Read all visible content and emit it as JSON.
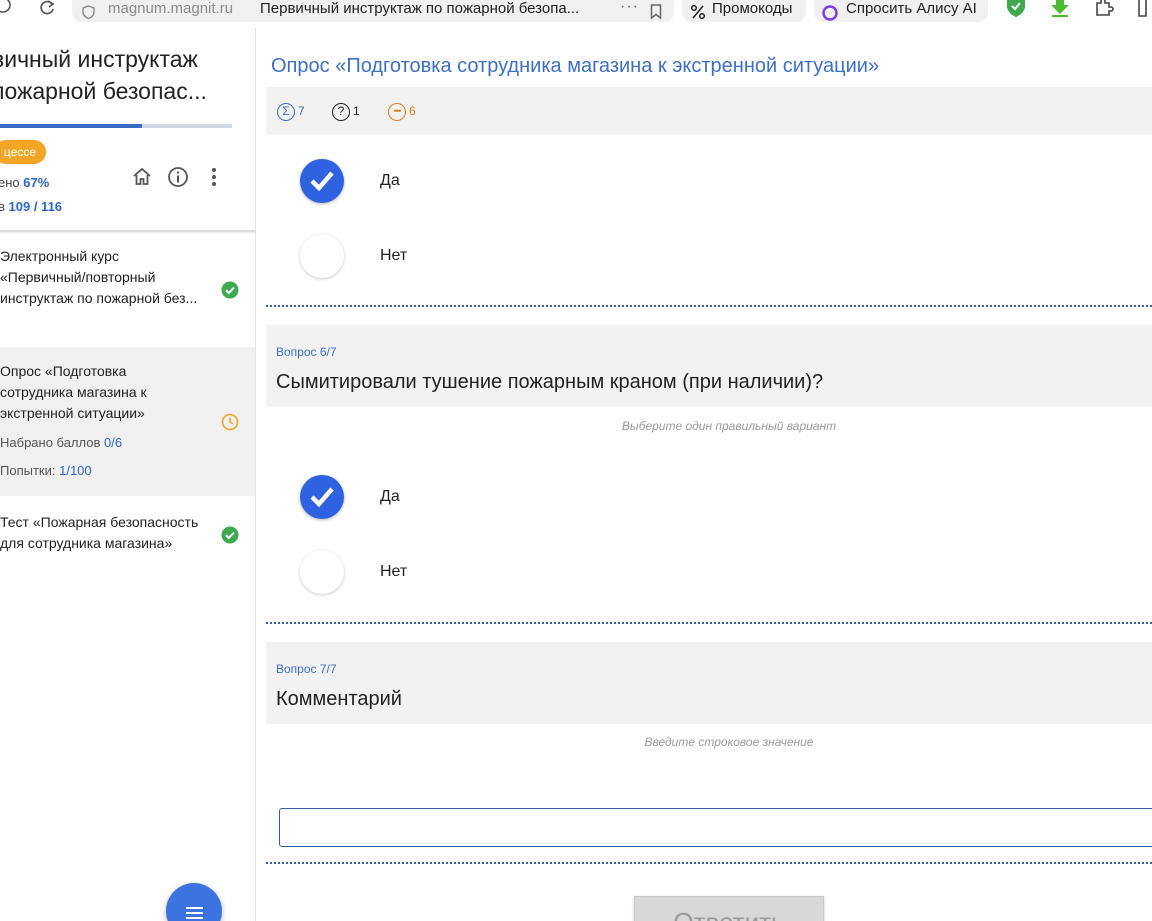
{
  "browser": {
    "domain": "magnum.magnit.ru",
    "page_title": "Первичный инструктаж по пожарной безопа...",
    "promo_label": "Промокоды",
    "alice_label": "Спросить Алису AI"
  },
  "sidebar": {
    "title_line1": "вичный инструктаж",
    "title_line2": "пожарной безопас...",
    "progress_fraction": 0.61,
    "status_badge": "цессе",
    "completed_label": "ено",
    "completed_value": "67%",
    "points_label": "в",
    "points_value": "109 / 116",
    "items": [
      {
        "label": "Электронный курс «Первичный/повторный инструктаж по пожарной без...",
        "status": "completed"
      },
      {
        "label": "Опрос «Подготовка сотрудника магазина к экстренной ситуации»",
        "status": "in-progress",
        "score_label": "Набрано баллов",
        "score_value": "0/6",
        "attempts_label": "Попытки:",
        "attempts_value": "1/100"
      },
      {
        "label": "Тест «Пожарная безопасность для сотрудника магазина»",
        "status": "completed"
      }
    ]
  },
  "main": {
    "title": "Опрос «Подготовка сотрудника магазина к экстренной ситуации»",
    "toolbar": {
      "total": "7",
      "unanswered": "1",
      "pending": "6"
    },
    "q5": {
      "options": [
        {
          "label": "Да",
          "checked": true
        },
        {
          "label": "Нет",
          "checked": false
        }
      ]
    },
    "q6": {
      "number": "Вопрос 6/7",
      "text": "Сымитировали тушение пожарным краном (при наличии)?",
      "hint": "Выберите один правильный вариант",
      "options": [
        {
          "label": "Да",
          "checked": true
        },
        {
          "label": "Нет",
          "checked": false
        }
      ]
    },
    "q7": {
      "number": "Вопрос 7/7",
      "text": "Комментарий",
      "hint": "Введите строковое значение",
      "value": ""
    },
    "submit_label": "Ответить"
  },
  "colors": {
    "accent": "#3d6fc4",
    "radio_checked": "#2f62e0",
    "badge": "#f2a623",
    "success": "#3daa4f",
    "warning": "#f2a623"
  }
}
